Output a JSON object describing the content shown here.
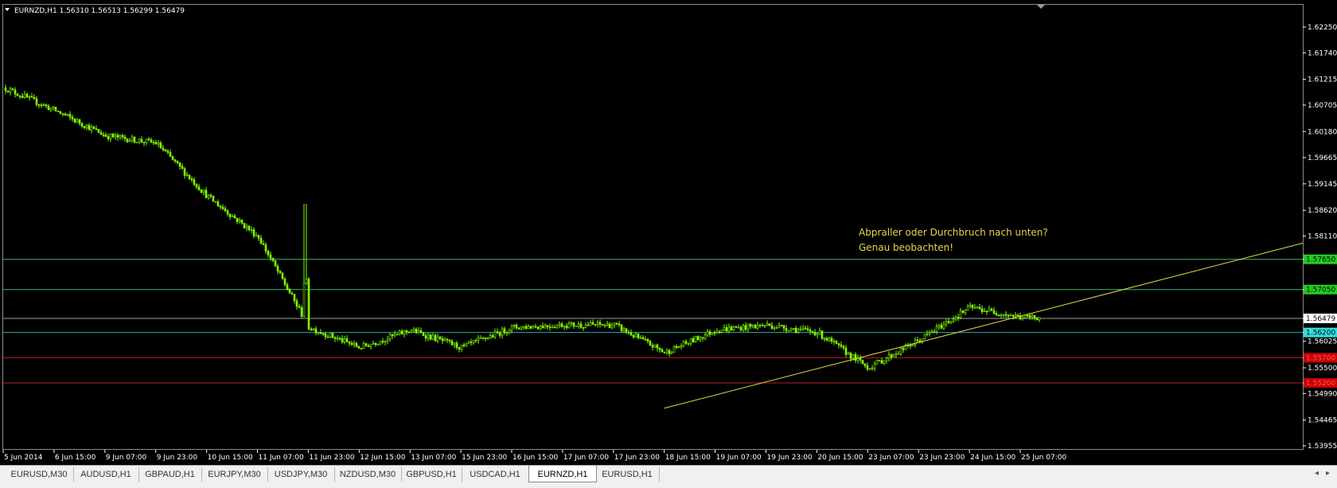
{
  "chart": {
    "symbol_info": "EURNZD,H1  1.56310 1.56513 1.56299 1.56479",
    "price_axis": [
      "1.62250",
      "1.61740",
      "1.61215",
      "1.60705",
      "1.60180",
      "1.59665",
      "1.59145",
      "1.58620",
      "1.58110",
      "1.57650",
      "1.57050",
      "1.56479",
      "1.56200",
      "1.56025",
      "1.55700",
      "1.55500",
      "1.55200",
      "1.54990",
      "1.54465",
      "1.53955"
    ],
    "time_axis": [
      "5 Jun 2014",
      "6 Jun 15:00",
      "9 Jun 07:00",
      "9 Jun 23:00",
      "10 Jun 15:00",
      "11 Jun 07:00",
      "11 Jun 23:00",
      "12 Jun 15:00",
      "13 Jun 07:00",
      "15 Jun 23:00",
      "16 Jun 15:00",
      "17 Jun 07:00",
      "17 Jun 23:00",
      "18 Jun 15:00",
      "19 Jun 07:00",
      "19 Jun 23:00",
      "20 Jun 15:00",
      "23 Jun 07:00",
      "23 Jun 23:00",
      "24 Jun 15:00",
      "25 Jun 07:00"
    ],
    "annotation": {
      "line1": "Abpraller oder Durchbruch nach unten?",
      "line2": "Genau beobachten!",
      "color": "#e8d64a"
    },
    "levels": [
      {
        "price": 1.5765,
        "label": "1.57650",
        "line_color": "#3cb371",
        "box_color": "#22cc22",
        "text_color": "#000000"
      },
      {
        "price": 1.5705,
        "label": "1.57050",
        "line_color": "#3cb371",
        "box_color": "#22cc22",
        "text_color": "#000000"
      },
      {
        "price": 1.56479,
        "label": "1.56479",
        "line_color": "#9e9e9e",
        "box_color": "#ffffff",
        "text_color": "#000000"
      },
      {
        "price": 1.562,
        "label": "1.56200",
        "line_color": "#20b2aa",
        "box_color": "#33dddd",
        "text_color": "#000000"
      },
      {
        "price": 1.557,
        "label": "1.55700",
        "line_color": "#b22222",
        "box_color": "#cc0000",
        "text_color": "#ff5555"
      },
      {
        "price": 1.552,
        "label": "1.55200",
        "line_color": "#b22222",
        "box_color": "#cc0000",
        "text_color": "#ff5555"
      }
    ],
    "trendline": {
      "from": [
        "18 Jun 15:00",
        1.547
      ],
      "to": [
        "right edge",
        1.5797
      ],
      "color": "#e8d64a"
    },
    "candle_color": "#7fff00",
    "closes_by_tick": [
      1.6105,
      1.606,
      1.601,
      1.5995,
      1.589,
      1.581,
      1.563,
      1.559,
      1.5625,
      1.559,
      1.563,
      1.5635,
      1.5635,
      1.558,
      1.5625,
      1.5635,
      1.562,
      1.555,
      1.5605,
      1.567,
      1.565
    ]
  },
  "tabs": [
    "EURUSD,M30",
    "AUDUSD,H1",
    "GBPAUD,H1",
    "EURJPY,M30",
    "USDJPY,M30",
    "NZDUSD,M30",
    "GBPUSD,H1",
    "USDCAD,H1",
    "EURNZD,H1",
    "EURUSD,H1"
  ],
  "active_tab": "EURNZD,H1",
  "scroll": {
    "left": "◂",
    "right": "▸"
  }
}
